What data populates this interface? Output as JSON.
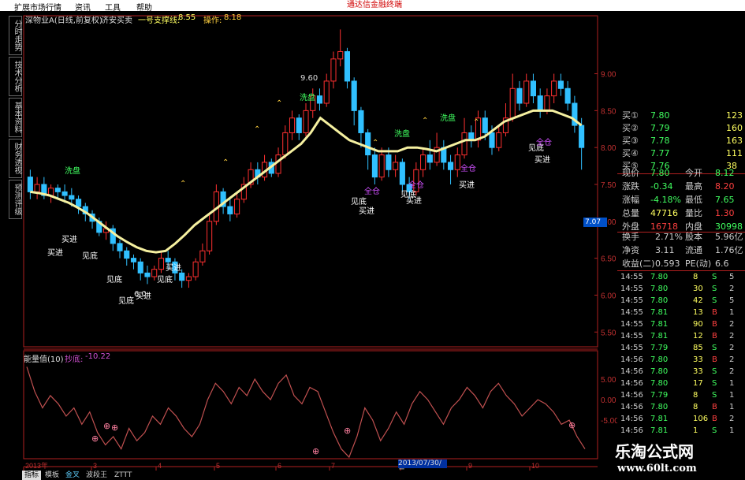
{
  "menu": {
    "items": [
      "扩展市场行情",
      "资讯",
      "工具",
      "帮助"
    ],
    "banner": "通达信金融终端"
  },
  "sidetabs": [
    "分时走势",
    "技术分析",
    "基本资料",
    "财务透视",
    "预测评级"
  ],
  "chart_header": {
    "stock_title": "深物业A(日线,前复权)",
    "indicator": "济安买卖",
    "support_label": "一号支撑线:",
    "support_value": "8.55",
    "operate_label": "操作:",
    "operate_value": "8.18"
  },
  "indicator_header": {
    "name": "能量值(10)",
    "label": "抄底:",
    "value": "-10.22"
  },
  "price_axis": [
    "9.00",
    "8.50",
    "8.00",
    "7.50",
    "7.00",
    "6.50",
    "6.00",
    "5.50"
  ],
  "indicator_axis": [
    "5.00",
    "0.00",
    "-5.00"
  ],
  "price_tag": "7.07",
  "high_annotation": "9.60",
  "low_annotation": "6.0",
  "time_axis": [
    "2013年",
    "3",
    "4",
    "5",
    "6",
    "7",
    "8",
    "9",
    "10"
  ],
  "date_box": "2013/07/30/二",
  "signals": {
    "buy": "买进",
    "bottom": "见底",
    "wash": "洗盘",
    "full": "全仓"
  },
  "bottom_tabs": [
    "指标",
    "模板",
    "金叉",
    "波段王",
    "ZTTT"
  ],
  "quote_panel": {
    "bids": [
      {
        "label": "买①",
        "price": "7.80",
        "vol": "123"
      },
      {
        "label": "买②",
        "price": "7.79",
        "vol": "160"
      },
      {
        "label": "买③",
        "price": "7.78",
        "vol": "163"
      },
      {
        "label": "买④",
        "price": "7.77",
        "vol": "111"
      },
      {
        "label": "买⑤",
        "price": "7.76",
        "vol": "38"
      }
    ],
    "stats": [
      {
        "l1": "现价",
        "v1": "7.80",
        "l2": "今开",
        "v2": "8.12"
      },
      {
        "l1": "涨跌",
        "v1": "-0.34",
        "l2": "最高",
        "v2": "8.20"
      },
      {
        "l1": "涨幅",
        "v1": "-4.18%",
        "l2": "最低",
        "v2": "7.65"
      },
      {
        "l1": "总量",
        "v1": "47716",
        "l2": "量比",
        "v2": "1.30"
      },
      {
        "l1": "外盘",
        "v1": "16718",
        "l2": "内盘",
        "v2": "30998"
      }
    ],
    "stats2": [
      {
        "l1": "换手",
        "v1": "2.71%",
        "l2": "股本",
        "v2": "5.96亿"
      },
      {
        "l1": "净资",
        "v1": "3.11",
        "l2": "流通",
        "v2": "1.76亿"
      },
      {
        "l1": "收益(二)",
        "v1": "0.593",
        "l2": "PE(动)",
        "v2": "6.6"
      }
    ],
    "ticks": [
      {
        "t": "14:55",
        "p": "7.80",
        "v": "8",
        "d": "S",
        "n": "5"
      },
      {
        "t": "14:55",
        "p": "7.80",
        "v": "30",
        "d": "S",
        "n": "2"
      },
      {
        "t": "14:55",
        "p": "7.80",
        "v": "42",
        "d": "S",
        "n": "5"
      },
      {
        "t": "14:55",
        "p": "7.81",
        "v": "13",
        "d": "B",
        "n": "1"
      },
      {
        "t": "14:55",
        "p": "7.81",
        "v": "90",
        "d": "B",
        "n": "2"
      },
      {
        "t": "14:55",
        "p": "7.81",
        "v": "12",
        "d": "B",
        "n": "2"
      },
      {
        "t": "14:55",
        "p": "7.79",
        "v": "85",
        "d": "S",
        "n": "2"
      },
      {
        "t": "14:56",
        "p": "7.80",
        "v": "33",
        "d": "B",
        "n": "2"
      },
      {
        "t": "14:56",
        "p": "7.80",
        "v": "33",
        "d": "S",
        "n": "2"
      },
      {
        "t": "14:56",
        "p": "7.80",
        "v": "17",
        "d": "S",
        "n": "1"
      },
      {
        "t": "14:56",
        "p": "7.79",
        "v": "8",
        "d": "S",
        "n": "1"
      },
      {
        "t": "14:56",
        "p": "7.80",
        "v": "8",
        "d": "B",
        "n": "1"
      },
      {
        "t": "14:56",
        "p": "7.81",
        "v": "106",
        "d": "B",
        "n": "2"
      },
      {
        "t": "14:56",
        "p": "7.81",
        "v": "1",
        "d": "S",
        "n": "1"
      }
    ]
  },
  "watermark": {
    "title": "乐淘公式网",
    "url": "www.60lt.com"
  },
  "colors": {
    "up": "#ff3030",
    "down": "#30c0ff",
    "ma": "#f5f0a0",
    "grid": "#7a1010",
    "axis": "#b02020",
    "energy": "#c05050",
    "buy": "#ffffff",
    "wash": "#40ff60",
    "full": "#d050ff"
  },
  "chart_data": {
    "type": "candlestick",
    "title": "深物业A(日线,前复权)",
    "ylim": [
      5.3,
      9.7
    ],
    "candles": [
      [
        7.6,
        7.4,
        7.7,
        7.3
      ],
      [
        7.4,
        7.5,
        7.6,
        7.3
      ],
      [
        7.5,
        7.35,
        7.6,
        7.3
      ],
      [
        7.35,
        7.45,
        7.5,
        7.25
      ],
      [
        7.45,
        7.4,
        7.5,
        7.3
      ],
      [
        7.4,
        7.35,
        7.5,
        7.25
      ],
      [
        7.35,
        7.3,
        7.45,
        7.2
      ],
      [
        7.3,
        7.2,
        7.35,
        7.1
      ],
      [
        7.2,
        7.1,
        7.25,
        7.0
      ],
      [
        7.1,
        7.0,
        7.15,
        6.9
      ],
      [
        7.0,
        6.85,
        7.05,
        6.8
      ],
      [
        6.85,
        6.9,
        7.0,
        6.75
      ],
      [
        6.9,
        6.7,
        6.95,
        6.6
      ],
      [
        6.7,
        6.6,
        6.75,
        6.5
      ],
      [
        6.6,
        6.5,
        6.65,
        6.4
      ],
      [
        6.5,
        6.45,
        6.55,
        6.35
      ],
      [
        6.45,
        6.3,
        6.5,
        6.2
      ],
      [
        6.3,
        6.25,
        6.4,
        6.15
      ],
      [
        6.25,
        6.35,
        6.4,
        6.2
      ],
      [
        6.35,
        6.5,
        6.6,
        6.3
      ],
      [
        6.5,
        6.45,
        6.6,
        6.35
      ],
      [
        6.45,
        6.3,
        6.5,
        6.2
      ],
      [
        6.3,
        6.2,
        6.35,
        6.1
      ],
      [
        6.2,
        6.25,
        6.3,
        6.1
      ],
      [
        6.25,
        6.45,
        6.5,
        6.2
      ],
      [
        6.45,
        6.6,
        6.7,
        6.4
      ],
      [
        6.6,
        7.0,
        7.1,
        6.55
      ],
      [
        7.0,
        7.4,
        7.5,
        6.95
      ],
      [
        7.4,
        7.2,
        7.45,
        7.1
      ],
      [
        7.2,
        7.1,
        7.3,
        7.0
      ],
      [
        7.1,
        7.3,
        7.4,
        7.05
      ],
      [
        7.3,
        7.5,
        7.6,
        7.25
      ],
      [
        7.5,
        7.7,
        7.8,
        7.45
      ],
      [
        7.7,
        7.6,
        7.8,
        7.5
      ],
      [
        7.6,
        7.8,
        7.9,
        7.55
      ],
      [
        7.8,
        7.65,
        7.85,
        7.6
      ],
      [
        7.65,
        7.9,
        8.0,
        7.6
      ],
      [
        7.9,
        8.2,
        8.3,
        7.85
      ],
      [
        8.2,
        8.4,
        8.5,
        8.1
      ],
      [
        8.4,
        8.2,
        8.45,
        8.1
      ],
      [
        8.2,
        8.5,
        8.6,
        8.15
      ],
      [
        8.5,
        8.7,
        8.8,
        8.4
      ],
      [
        8.7,
        8.6,
        8.8,
        8.5
      ],
      [
        8.6,
        8.9,
        9.0,
        8.55
      ],
      [
        8.9,
        9.2,
        9.3,
        8.8
      ],
      [
        9.2,
        9.3,
        9.6,
        9.1
      ],
      [
        9.3,
        8.9,
        9.35,
        8.8
      ],
      [
        8.9,
        8.5,
        8.95,
        8.3
      ],
      [
        8.5,
        8.2,
        8.55,
        8.0
      ],
      [
        8.2,
        7.9,
        8.25,
        7.7
      ],
      [
        7.9,
        7.6,
        8.0,
        7.5
      ],
      [
        7.6,
        7.9,
        8.0,
        7.55
      ],
      [
        7.9,
        7.7,
        8.0,
        7.6
      ],
      [
        7.7,
        7.8,
        7.9,
        7.6
      ],
      [
        7.8,
        7.5,
        7.85,
        7.4
      ],
      [
        7.5,
        7.4,
        7.6,
        7.3
      ],
      [
        7.4,
        7.7,
        7.8,
        7.35
      ],
      [
        7.7,
        7.9,
        8.0,
        7.6
      ],
      [
        7.9,
        7.8,
        8.1,
        7.7
      ],
      [
        7.8,
        8.0,
        8.2,
        7.75
      ],
      [
        8.0,
        7.8,
        8.1,
        7.7
      ],
      [
        7.8,
        7.7,
        7.9,
        7.5
      ],
      [
        7.7,
        7.9,
        8.0,
        7.6
      ],
      [
        7.9,
        8.2,
        8.4,
        7.85
      ],
      [
        8.2,
        8.1,
        8.3,
        8.0
      ],
      [
        8.1,
        8.4,
        8.5,
        8.0
      ],
      [
        8.4,
        8.2,
        8.5,
        8.1
      ],
      [
        8.2,
        8.0,
        8.3,
        7.9
      ],
      [
        8.0,
        8.2,
        8.3,
        7.95
      ],
      [
        8.2,
        8.4,
        8.6,
        8.15
      ],
      [
        8.4,
        8.8,
        9.0,
        8.35
      ],
      [
        8.8,
        8.6,
        8.9,
        8.5
      ],
      [
        8.6,
        8.9,
        9.0,
        8.55
      ],
      [
        8.9,
        8.7,
        9.0,
        8.6
      ],
      [
        8.7,
        8.5,
        8.8,
        8.4
      ],
      [
        8.5,
        8.7,
        8.8,
        8.45
      ],
      [
        8.7,
        8.9,
        9.0,
        8.6
      ],
      [
        8.9,
        8.8,
        9.0,
        8.7
      ],
      [
        8.8,
        8.6,
        8.9,
        8.5
      ],
      [
        8.6,
        8.3,
        8.7,
        8.2
      ],
      [
        8.3,
        8.0,
        8.4,
        7.7
      ]
    ],
    "ma": [
      7.4,
      7.38,
      7.35,
      7.3,
      7.25,
      7.18,
      7.1,
      7.0,
      6.9,
      6.8,
      6.72,
      6.65,
      6.6,
      6.58,
      6.6,
      6.7,
      6.82,
      6.95,
      7.05,
      7.15,
      7.25,
      7.35,
      7.45,
      7.55,
      7.65,
      7.75,
      7.85,
      7.95,
      8.05,
      8.2,
      8.4,
      8.3,
      8.2,
      8.1,
      8.05,
      8.0,
      7.95,
      7.95,
      7.95,
      8.0,
      8.0,
      7.98,
      7.95,
      8.0,
      8.05,
      8.1,
      8.1,
      8.15,
      8.25,
      8.35,
      8.4,
      8.45,
      8.5,
      8.5,
      8.5,
      8.45,
      8.4,
      8.3
    ]
  }
}
